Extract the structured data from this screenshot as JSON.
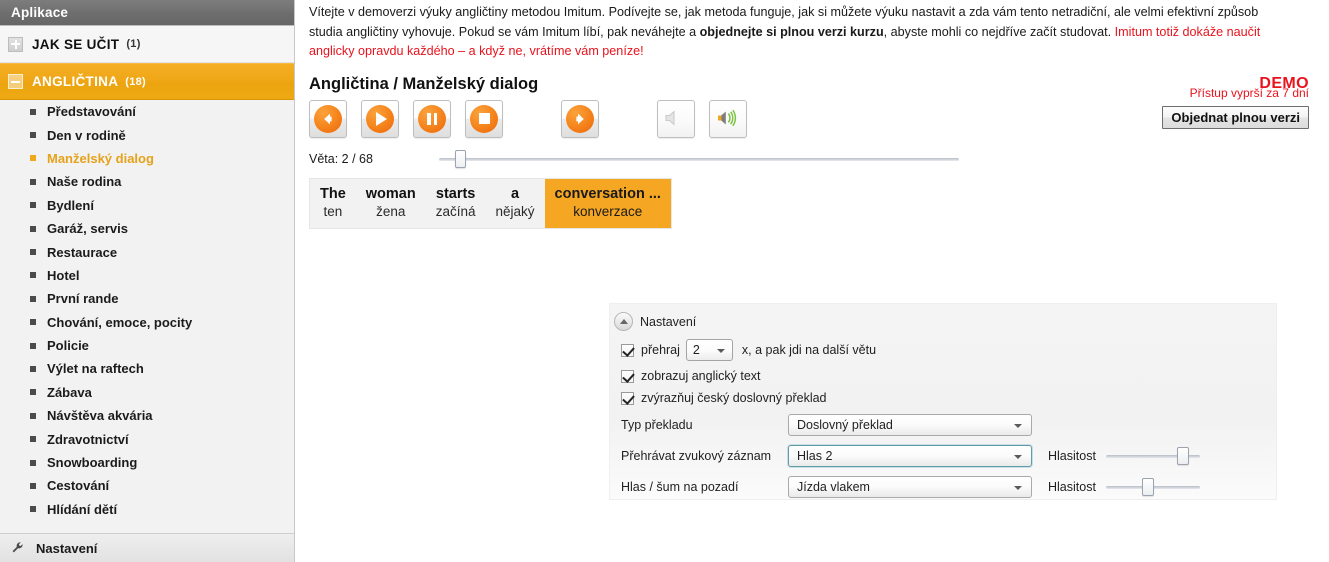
{
  "sidebar": {
    "header": "Aplikace",
    "groups": [
      {
        "label": "JAK SE UČIT",
        "count": "(1)",
        "state": "collapsed",
        "toggle": "plus-icon"
      },
      {
        "label": "ANGLIČTINA",
        "count": "(18)",
        "state": "expanded",
        "toggle": "minus-icon"
      }
    ],
    "items": [
      {
        "label": "Představování",
        "active": false
      },
      {
        "label": "Den v rodině",
        "active": false
      },
      {
        "label": "Manželský dialog",
        "active": true
      },
      {
        "label": "Naše rodina",
        "active": false
      },
      {
        "label": "Bydlení",
        "active": false
      },
      {
        "label": "Garáž, servis",
        "active": false
      },
      {
        "label": "Restaurace",
        "active": false
      },
      {
        "label": "Hotel",
        "active": false
      },
      {
        "label": "První rande",
        "active": false
      },
      {
        "label": "Chování, emoce, pocity",
        "active": false
      },
      {
        "label": "Policie",
        "active": false
      },
      {
        "label": "Výlet na raftech",
        "active": false
      },
      {
        "label": "Zábava",
        "active": false
      },
      {
        "label": "Návštěva akvária",
        "active": false
      },
      {
        "label": "Zdravotnictví",
        "active": false
      },
      {
        "label": "Snowboarding",
        "active": false
      },
      {
        "label": "Cestování",
        "active": false
      },
      {
        "label": "Hlídání dětí",
        "active": false
      }
    ],
    "footer": {
      "label": "Nastavení",
      "icon": "wrench-icon"
    }
  },
  "promo": {
    "part1": "Vítejte v demoverzi výuky angličtiny metodou Imitum. Podívejte se, jak metoda funguje, jak si můžete výuku nastavit a zda vám tento netradiční, ale velmi efektivní způsob studia angličtiny vyhovuje. Pokud se vám Imitum líbí, pak neváhejte a ",
    "bold": "objednejte si plnou verzi kurzu",
    "part2": ", abyste mohli co nejdříve začít studovat. ",
    "red": "Imitum totiž dokáže naučit anglicky opravdu každého – a když ne, vrátíme vám peníze!"
  },
  "header": {
    "title": "Angličtina / Manželský dialog",
    "demo_badge": "DEMO",
    "expire_text": "Přístup vyprší za 7 dní",
    "order_button": "Objednat plnou verzi"
  },
  "transport": {
    "buttons": [
      {
        "name": "previous-sentence-button",
        "icon": "arrow-left-circle-icon"
      },
      {
        "name": "play-button",
        "icon": "play-circle-icon"
      },
      {
        "name": "pause-button",
        "icon": "pause-circle-icon"
      },
      {
        "name": "stop-button",
        "icon": "stop-circle-icon"
      },
      {
        "name": "next-sentence-button",
        "icon": "arrow-right-circle-icon"
      }
    ],
    "mute_button": {
      "name": "mute-button",
      "icon": "speaker-mute-icon",
      "state": "inactive"
    },
    "sound_button": {
      "name": "sound-on-button",
      "icon": "speaker-on-icon",
      "state": "active"
    }
  },
  "timeline": {
    "label": "Věta: 2 / 68",
    "current": 2,
    "total": 68,
    "thumb_percent": 3
  },
  "sentence": {
    "words": [
      {
        "en": "The",
        "cs": "ten",
        "highlight": false
      },
      {
        "en": "woman",
        "cs": "žena",
        "highlight": false
      },
      {
        "en": "starts",
        "cs": "začíná",
        "highlight": false
      },
      {
        "en": "a",
        "cs": "nějaký",
        "highlight": false
      },
      {
        "en": "conversation ...",
        "cs": "konverzace",
        "highlight": true
      }
    ]
  },
  "settings": {
    "panel_title": "Nastavení",
    "collapse_icon": "chevron-up-icon",
    "repeat": {
      "checked": true,
      "label_before": "přehraj",
      "value": "2",
      "label_after": "x, a pak jdi na další větu"
    },
    "checkboxes": [
      {
        "label": "zobrazuj anglický text",
        "checked": true
      },
      {
        "label": "zvýrazňuj český doslovný překlad",
        "checked": true
      }
    ],
    "rows": [
      {
        "label": "Typ překladu",
        "value": "Doslovný překlad",
        "focused": false,
        "has_volume": false
      },
      {
        "label": "Přehrávat zvukový záznam",
        "value": "Hlas 2",
        "focused": true,
        "has_volume": true,
        "volume_label": "Hlasitost",
        "volume_percent": 92
      },
      {
        "label": "Hlas / šum na pozadí",
        "value": "Jízda vlakem",
        "focused": false,
        "has_volume": true,
        "volume_label": "Hlasitost",
        "volume_percent": 47
      }
    ]
  },
  "colors": {
    "accent_orange": "#f0a71e",
    "highlight_orange": "#f5a623",
    "alert_red": "#e8131d",
    "sidebar_bg": "#f2f2f2",
    "header_gray": "#6e6e6e"
  }
}
